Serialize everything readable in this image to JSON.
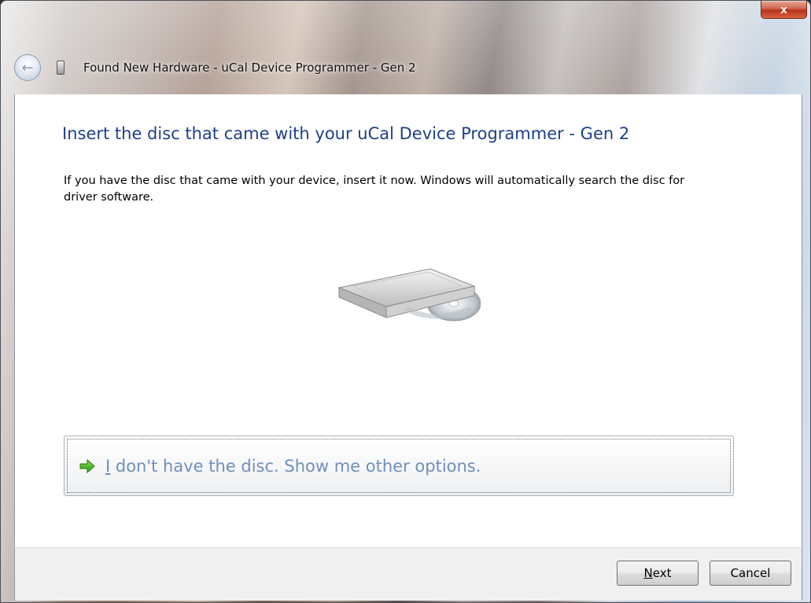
{
  "window": {
    "title": "Found New Hardware - uCal Device Programmer - Gen 2",
    "close_label": "x"
  },
  "main": {
    "heading": "Insert the disc that came with your uCal Device Programmer - Gen 2",
    "description": "If you have the disc that came with your device, insert it now.  Windows will automatically search the disc for driver software.",
    "option": {
      "mnemonic": "I",
      "label_rest": " don't have the disc.  Show me other options."
    }
  },
  "footer": {
    "next_mnemonic": "N",
    "next_rest": "ext",
    "cancel_label": "Cancel"
  },
  "icons": {
    "back": "back-arrow-icon",
    "device": "hardware-device-icon",
    "disc": "disc-drive-icon",
    "option_arrow": "green-arrow-icon"
  },
  "colors": {
    "heading": "#1e3f8a",
    "option_link": "#6f8fbe",
    "close_button": "#c8452c"
  }
}
